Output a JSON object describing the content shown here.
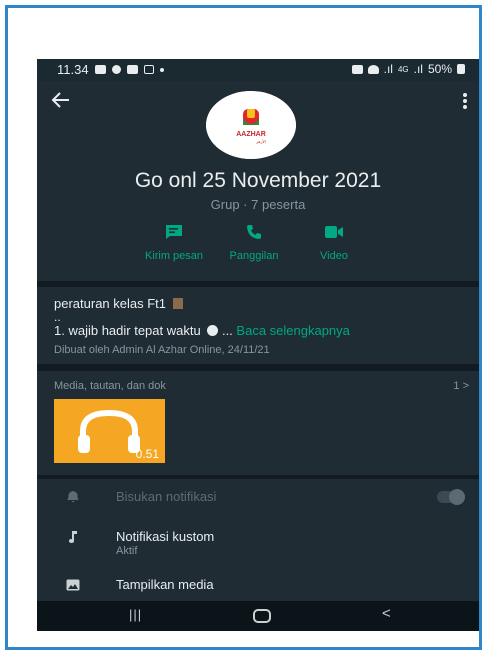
{
  "status": {
    "time": "11.34",
    "network": "4G",
    "battery": "50%"
  },
  "header": {
    "back_icon": "arrow-left-icon",
    "menu_icon": "more-vertical-icon",
    "avatar_text": "AAZHAR",
    "group_name": "Go onl 25 November 2021",
    "group_meta": "Grup · 7 peserta",
    "actions": [
      {
        "label": "Kirim pesan",
        "icon": "message-icon"
      },
      {
        "label": "Panggilan",
        "icon": "phone-icon"
      },
      {
        "label": "Video",
        "icon": "video-icon"
      }
    ]
  },
  "description": {
    "line1": "peraturan kelas Ft1",
    "line2": "..",
    "line3": "1. wajib hadir tepat waktu",
    "read_more": "Baca selengkapnya",
    "meta": "Dibuat oleh Admin Al Azhar Online, 24/11/21"
  },
  "media": {
    "title": "Media, tautan, dan dok",
    "count": "1 >",
    "thumb_duration": "0.51"
  },
  "settings": [
    {
      "title": "Bisukan notifikasi",
      "icon": "bell-icon",
      "muted": true
    },
    {
      "title": "Notifikasi kustom",
      "subtitle": "Aktif",
      "icon": "music-note-icon"
    },
    {
      "title": "Tampilkan media",
      "icon": "image-icon"
    }
  ],
  "navbar": {
    "recent": "|||",
    "home": "○",
    "back": "<"
  },
  "colors": {
    "accent": "#00a884",
    "background": "#111b21",
    "panel": "#1f2c33",
    "frame_border": "#2f86c8",
    "thumb": "#f5a623"
  }
}
